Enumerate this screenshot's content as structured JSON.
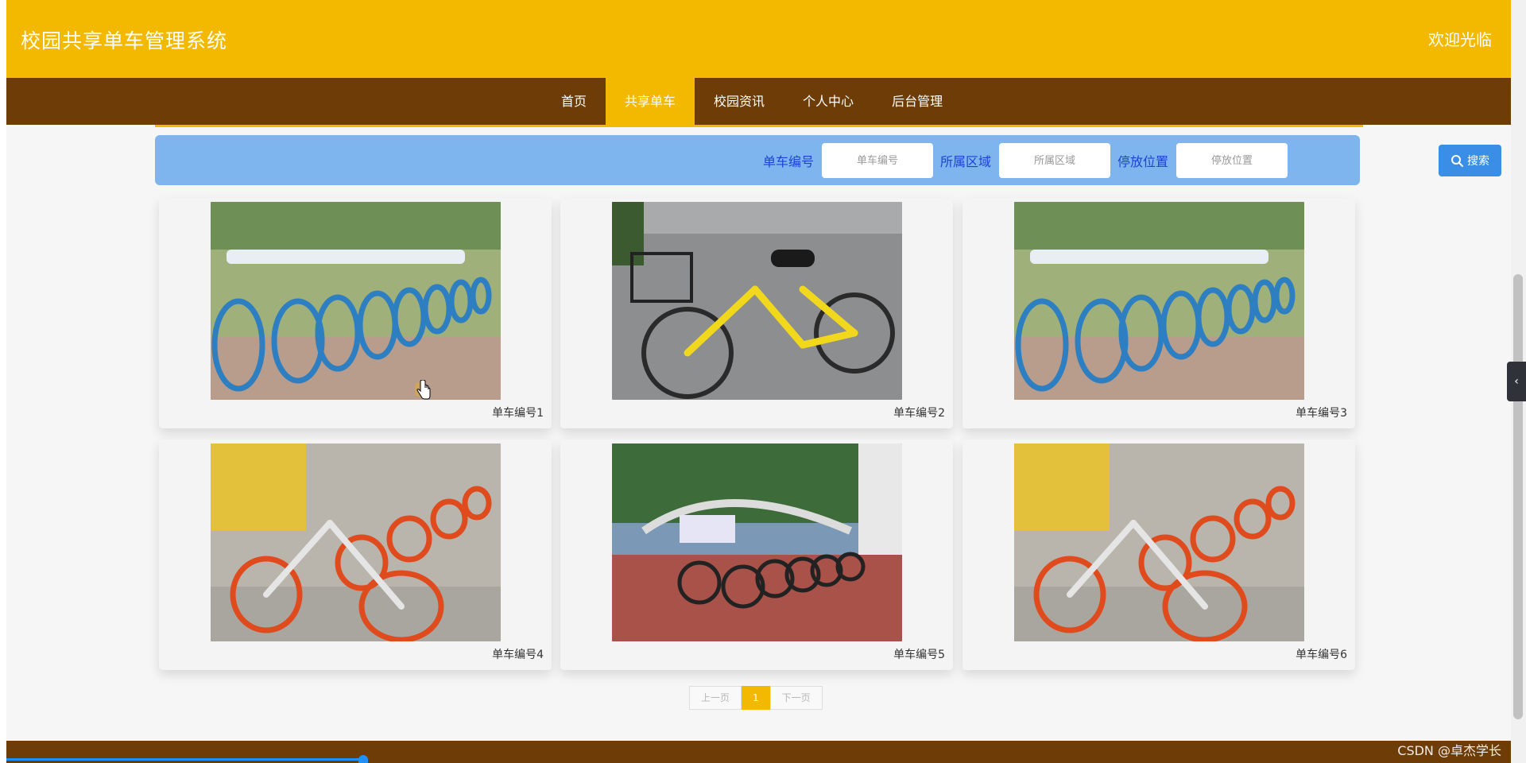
{
  "header": {
    "site_title": "校园共享单车管理系统",
    "welcome": "欢迎光临"
  },
  "nav": {
    "items": [
      {
        "label": "首页",
        "active": false
      },
      {
        "label": "共享单车",
        "active": true
      },
      {
        "label": "校园资讯",
        "active": false
      },
      {
        "label": "个人中心",
        "active": false
      },
      {
        "label": "后台管理",
        "active": false
      }
    ]
  },
  "search": {
    "fields": [
      {
        "label": "单车编号",
        "placeholder": "单车编号",
        "value": ""
      },
      {
        "label": "所属区域",
        "placeholder": "所属区域",
        "value": ""
      },
      {
        "label": "停放位置",
        "placeholder": "停放位置",
        "value": ""
      }
    ],
    "button_label": "搜索",
    "colors": {
      "bar": "#7eb5ef",
      "label": "#1a43d6",
      "button": "#3a8ee6"
    }
  },
  "bikes": [
    {
      "label": "单车编号1",
      "image": "blue-bikes-row"
    },
    {
      "label": "单车编号2",
      "image": "yellow-bike"
    },
    {
      "label": "单车编号3",
      "image": "blue-bikes-row"
    },
    {
      "label": "单车编号4",
      "image": "orange-bikes-row"
    },
    {
      "label": "单车编号5",
      "image": "bikes-at-station"
    },
    {
      "label": "单车编号6",
      "image": "orange-bikes-row"
    }
  ],
  "pagination": {
    "prev": "上一页",
    "current": "1",
    "next": "下一页"
  },
  "watermark": "CSDN @卓杰学长",
  "side_tab_icon": "chevron-left-icon",
  "colors": {
    "header": "#f3b800",
    "nav": "#6e3c06",
    "active_nav": "#f3b800"
  }
}
